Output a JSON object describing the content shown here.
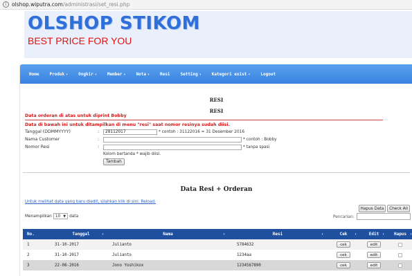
{
  "url": {
    "host": "olshop.wiputra.com",
    "path": "/administrasi/set_resi.php"
  },
  "banner": {
    "title": "OLSHOP STIKOM",
    "subtitle": "BEST PRICE FOR YOU"
  },
  "nav": {
    "items": [
      {
        "label": "Home",
        "dropdown": false
      },
      {
        "label": "Produk",
        "dropdown": true
      },
      {
        "label": "Ongkir",
        "dropdown": true
      },
      {
        "label": "Member",
        "dropdown": true
      },
      {
        "label": "Nota",
        "dropdown": true
      },
      {
        "label": "Resi",
        "dropdown": false
      },
      {
        "label": "Setting",
        "dropdown": true
      },
      {
        "label": "Kategori exist",
        "dropdown": true
      },
      {
        "label": "Logout",
        "dropdown": false
      }
    ]
  },
  "form": {
    "heading1": "RESI",
    "heading2": "RESI",
    "note_print": "Data orderan di atas untuk diprint Bobby",
    "note_resi": "Data di bawah ini untuk ditampilkan di menu \"resi\" saat nomor resinya sudah diisi.",
    "fields": {
      "tanggal": {
        "label": "Tanggal (DDMMYYYY)",
        "value": "28112017",
        "hint": "* contoh : 31122016 = 31 Desember 2016"
      },
      "customer": {
        "label": "Nama Customer",
        "value": "",
        "hint": "* contoh : Bobby"
      },
      "resi": {
        "label": "Nomor Resi",
        "value": "",
        "hint": "* tanpa spasi"
      }
    },
    "required_note": "Kolom bertanda * wajib diisi.",
    "submit_label": "Tambah"
  },
  "data_section": {
    "title": "Data Resi + Orderan",
    "reload_link": "Untuk melihat data yang baru diedit, silahkan klik di sini. Reload.",
    "delete_button": "Hapus Data",
    "check_all_button": "Check All",
    "show_prefix": "Menampilkan",
    "show_value": "10",
    "show_suffix": "data",
    "search_label": "Pencarian:",
    "search_value": ""
  },
  "table": {
    "headers": {
      "no": "No.",
      "tanggal": "Tanggal",
      "nama": "Nama",
      "resi": "Resi",
      "cek": "Cek",
      "edit": "Edit",
      "hapus": "Hapus"
    },
    "rows": [
      {
        "no": "1",
        "tanggal": "31-10-2017",
        "nama": "Julianto",
        "resi": "5784632",
        "cek": "cek",
        "edit": "edit"
      },
      {
        "no": "2",
        "tanggal": "31-10-2017",
        "nama": "Julianto",
        "resi": "1234aa",
        "cek": "cek",
        "edit": "edit"
      },
      {
        "no": "3",
        "tanggal": "22-08-2016",
        "nama": "Jono Yoshikox",
        "resi": "1234567890",
        "cek": "cek",
        "edit": "edit"
      }
    ]
  }
}
